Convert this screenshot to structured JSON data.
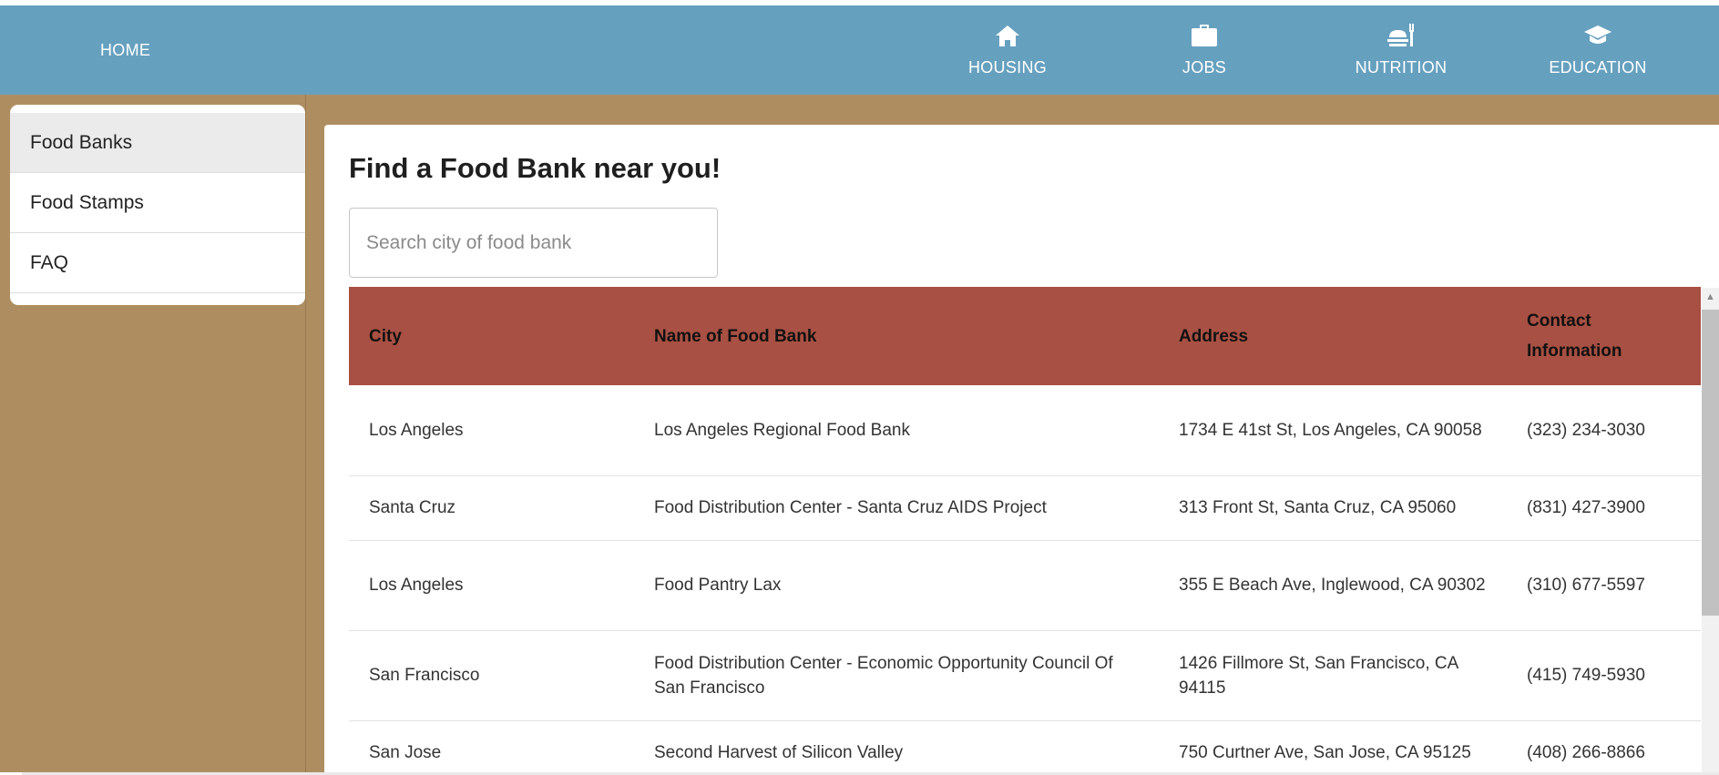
{
  "nav": {
    "home": "HOME",
    "items": [
      {
        "label": "HOUSING",
        "icon": "house-icon"
      },
      {
        "label": "JOBS",
        "icon": "briefcase-icon"
      },
      {
        "label": "NUTRITION",
        "icon": "fork-plate-icon"
      },
      {
        "label": "EDUCATION",
        "icon": "graduation-cap-icon"
      }
    ]
  },
  "sidebar": {
    "items": [
      {
        "label": "Food Banks",
        "active": true
      },
      {
        "label": "Food Stamps",
        "active": false
      },
      {
        "label": "FAQ",
        "active": false
      }
    ]
  },
  "main": {
    "title": "Find a Food Bank near you!",
    "search_placeholder": "Search city of food bank",
    "table": {
      "headers": [
        "City",
        "Name of Food Bank",
        "Address",
        "Contact Information"
      ],
      "rows": [
        [
          "Los Angeles",
          "Los Angeles Regional Food Bank",
          "1734 E 41st St, Los Angeles, CA 90058",
          "(323) 234-3030"
        ],
        [
          "Santa Cruz",
          "Food Distribution Center - Santa Cruz AIDS Project",
          "313 Front St, Santa Cruz, CA 95060",
          "(831) 427-3900"
        ],
        [
          "Los Angeles",
          "Food Pantry Lax",
          "355 E Beach Ave, Inglewood, CA 90302",
          "(310) 677-5597"
        ],
        [
          "San Francisco",
          "Food Distribution Center - Economic Opportunity Council Of San Francisco",
          "1426 Fillmore St, San Francisco, CA 94115",
          "(415) 749-5930"
        ],
        [
          "San Jose",
          "Second Harvest of Silicon Valley",
          "750 Curtner Ave, San Jose, CA 95125",
          "(408) 266-8866"
        ]
      ]
    }
  },
  "colors": {
    "navbar": "#66a0bf",
    "page_background": "#ae8e61",
    "table_header": "#a85043"
  }
}
